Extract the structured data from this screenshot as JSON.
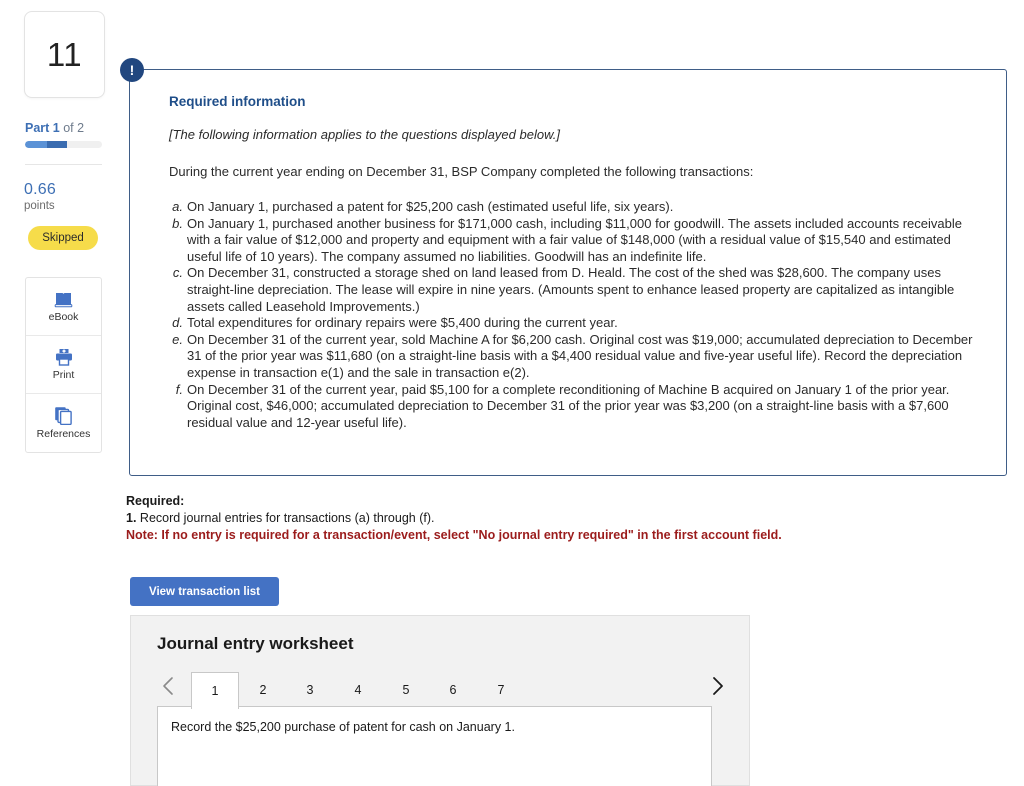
{
  "question": {
    "number": "11",
    "part_label_prefix": "Part 1",
    "part_label_suffix": " of 2",
    "points_value": "0.66",
    "points_word": "points",
    "status": "Skipped",
    "progress_percent": 55
  },
  "tools": [
    {
      "label": "eBook",
      "icon": "book-icon"
    },
    {
      "label": "Print",
      "icon": "printer-icon"
    },
    {
      "label": "References",
      "icon": "copy-pages-icon"
    }
  ],
  "info_panel": {
    "badge": "!",
    "heading": "Required information",
    "italic_note": "[The following information applies to the questions displayed below.]",
    "intro": "During the current year ending on December 31, BSP Company completed the following transactions:",
    "transactions": [
      {
        "marker": "a.",
        "text": "On January 1, purchased a patent for $25,200 cash (estimated useful life, six years)."
      },
      {
        "marker": "b.",
        "text": "On January 1, purchased another business for $171,000 cash, including $11,000 for goodwill. The assets included accounts receivable with a fair value of $12,000 and property and equipment with a fair value of $148,000 (with a residual value of $15,540 and estimated useful life of 10 years). The company assumed no liabilities. Goodwill has an indefinite life."
      },
      {
        "marker": "c.",
        "text": "On December 31, constructed a storage shed on land leased from D. Heald. The cost of the shed was $28,600. The company uses straight-line depreciation. The lease will expire in nine years. (Amounts spent to enhance leased property are capitalized as intangible assets called Leasehold Improvements.)"
      },
      {
        "marker": "d.",
        "text": "Total expenditures for ordinary repairs were $5,400 during the current year."
      },
      {
        "marker": "e.",
        "text": "On December 31 of the current year, sold Machine A for $6,200 cash. Original cost was $19,000; accumulated depreciation to December 31 of the prior year was $11,680 (on a straight-line basis with a $4,400 residual value and five-year useful life). Record the depreciation expense in transaction e(1) and the sale in transaction e(2)."
      },
      {
        "marker": "f.",
        "text": "On December 31 of the current year, paid $5,100 for a complete reconditioning of Machine B acquired on January 1 of the prior year. Original cost, $46,000; accumulated depreciation to December 31 of the prior year was $3,200 (on a straight-line basis with a $7,600 residual value and 12-year useful life)."
      }
    ]
  },
  "required": {
    "title": "Required:",
    "item_number": "1.",
    "item_text": " Record journal entries for transactions (a) through (f).",
    "note": "Note: If no entry is required for a transaction/event, select \"No journal entry required\" in the first account field."
  },
  "view_transaction_button": "View transaction list",
  "worksheet": {
    "title": "Journal entry worksheet",
    "tabs": [
      "1",
      "2",
      "3",
      "4",
      "5",
      "6",
      "7"
    ],
    "active_tab_index": 0,
    "prev_icon": "chevron-left-icon",
    "next_icon": "chevron-right-icon",
    "body_text": "Record the $25,200 purchase of patent for cash on January 1."
  },
  "colors": {
    "brand_blue": "#4472c4",
    "heading_blue": "#1f4e89",
    "panel_border": "#3f5d87",
    "badge_navy": "#21477f",
    "status_yellow": "#f6dc4a",
    "note_red": "#9b1c1c"
  }
}
